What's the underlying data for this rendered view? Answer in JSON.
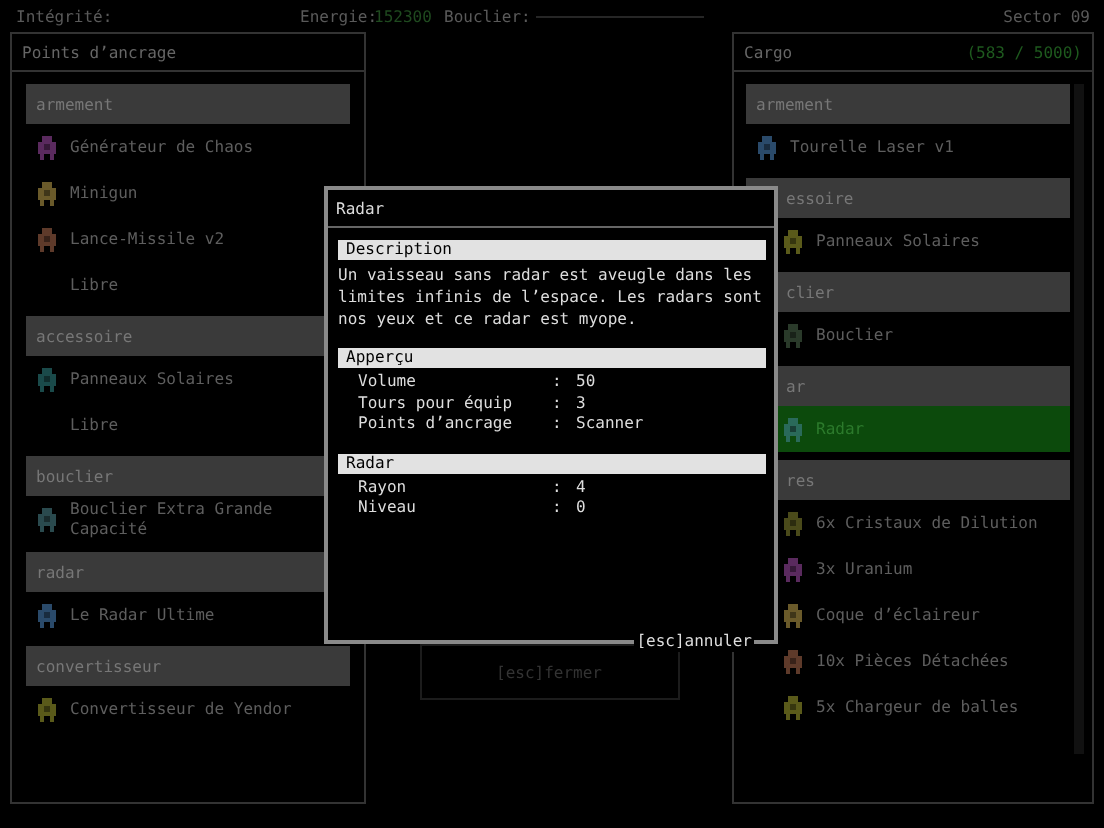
{
  "hud": {
    "integrity_label": "Intégrité:",
    "energy_label": "Energie:",
    "energy_value": "152300",
    "shield_label": "Bouclier:",
    "sector": "Sector 09"
  },
  "hardpoints": {
    "title": "Points d’ancrage",
    "groups": [
      {
        "label": "armement",
        "items": [
          {
            "name": "Générateur de Chaos",
            "kind": "equipment"
          },
          {
            "name": "Minigun",
            "kind": "equipment"
          },
          {
            "name": "Lance-Missile v2",
            "kind": "equipment"
          },
          {
            "name": "Libre",
            "kind": "empty"
          }
        ]
      },
      {
        "label": "accessoire",
        "items": [
          {
            "name": "Panneaux Solaires",
            "kind": "equipment"
          },
          {
            "name": "Libre",
            "kind": "empty"
          }
        ]
      },
      {
        "label": "bouclier",
        "items": [
          {
            "name": "Bouclier Extra Grande Capacité",
            "kind": "equipment"
          }
        ]
      },
      {
        "label": "radar",
        "items": [
          {
            "name": "Le Radar Ultime",
            "kind": "equipment"
          }
        ]
      },
      {
        "label": "convertisseur",
        "items": [
          {
            "name": "Convertisseur de Yendor",
            "kind": "equipment"
          }
        ]
      }
    ]
  },
  "cargo": {
    "title": "Cargo",
    "capacity": "(583 / 5000)",
    "groups": [
      {
        "label": "armement",
        "partly_hidden": false,
        "items": [
          {
            "name": "Tourelle Laser v1",
            "selected": false
          }
        ]
      },
      {
        "label": "essoire",
        "partly_hidden": true,
        "items": [
          {
            "name": "Panneaux Solaires",
            "selected": false
          }
        ]
      },
      {
        "label": "clier",
        "partly_hidden": true,
        "items": [
          {
            "name": "Bouclier",
            "selected": false
          }
        ]
      },
      {
        "label": "ar",
        "partly_hidden": true,
        "items": [
          {
            "name": "Radar",
            "selected": true
          }
        ]
      },
      {
        "label": "res",
        "partly_hidden": true,
        "items": [
          {
            "name": "6x Cristaux de Dilution",
            "selected": false
          },
          {
            "name": "3x Uranium",
            "selected": false
          },
          {
            "name": "Coque d’éclaireur",
            "selected": false
          },
          {
            "name": "10x Pièces Détachées",
            "selected": false
          },
          {
            "name": "5x Chargeur de balles",
            "selected": false
          }
        ]
      }
    ]
  },
  "detail_panel": {
    "close_hint": "[esc]fermer"
  },
  "dialog": {
    "title": "Radar",
    "cancel_hint": "[esc]annuler",
    "sections": [
      {
        "heading": "Description",
        "kind": "text",
        "text": "Un vaisseau sans radar est aveugle dans les limites infinis de l’espace. Les radars sont nos yeux et ce radar est myope."
      },
      {
        "heading": "Apperçu",
        "kind": "fields",
        "rows": [
          {
            "key": "Volume",
            "sep": ":",
            "value": "50"
          },
          {
            "key": "Tours pour équip",
            "sep": ":",
            "value": "3"
          },
          {
            "key": "Points d’ancrage",
            "sep": ":",
            "value": "Scanner"
          }
        ]
      },
      {
        "heading": "Radar",
        "kind": "fields",
        "rows": [
          {
            "key": "Rayon",
            "sep": ":",
            "value": "4"
          },
          {
            "key": "Niveau",
            "sep": ":",
            "value": "0"
          }
        ]
      }
    ]
  }
}
